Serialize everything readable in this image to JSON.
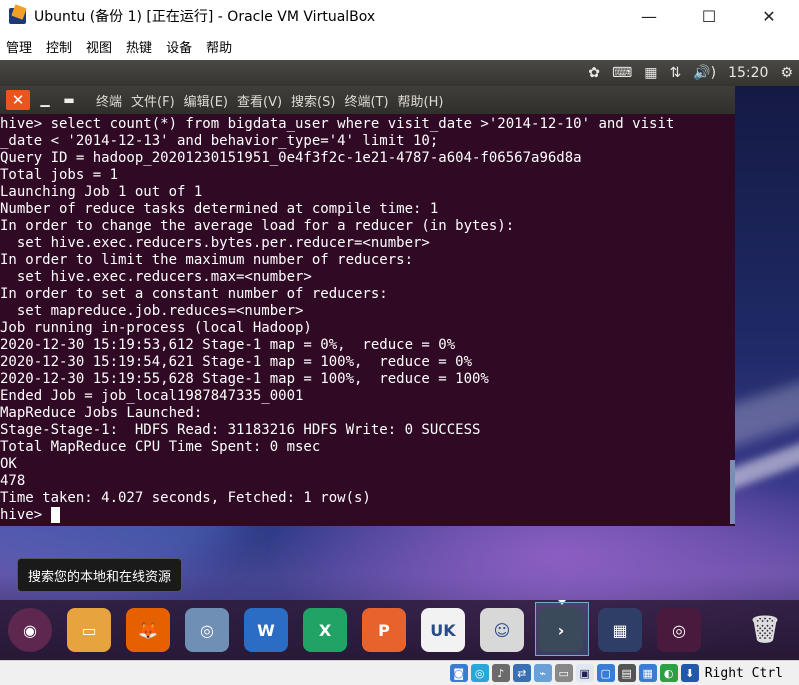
{
  "window": {
    "title": "Ubuntu (备份 1) [正在运行] - Oracle VM VirtualBox",
    "minimize": "—",
    "maximize": "☐",
    "close": "✕"
  },
  "vbox_menu": [
    "管理",
    "控制",
    "视图",
    "热键",
    "设备",
    "帮助"
  ],
  "ubuntu_panel": {
    "time": "15:20",
    "volume_icon": "🔊)",
    "icons": [
      "settings-icon",
      "keyboard-icon",
      "calendar-icon",
      "network-icon",
      "volume-icon"
    ]
  },
  "terminal": {
    "menu": [
      "终端",
      "文件(F)",
      "编辑(E)",
      "查看(V)",
      "搜索(S)",
      "终端(T)",
      "帮助(H)"
    ],
    "lines": [
      "hive> select count(*) from bigdata_user where visit_date >'2014-12-10' and visit",
      "_date < '2014-12-13' and behavior_type='4' limit 10;",
      "Query ID = hadoop_20201230151951_0e4f3f2c-1e21-4787-a604-f06567a96d8a",
      "Total jobs = 1",
      "Launching Job 1 out of 1",
      "Number of reduce tasks determined at compile time: 1",
      "In order to change the average load for a reducer (in bytes):",
      "  set hive.exec.reducers.bytes.per.reducer=<number>",
      "In order to limit the maximum number of reducers:",
      "  set hive.exec.reducers.max=<number>",
      "In order to set a constant number of reducers:",
      "  set mapreduce.job.reduces=<number>",
      "Job running in-process (local Hadoop)",
      "2020-12-30 15:19:53,612 Stage-1 map = 0%,  reduce = 0%",
      "2020-12-30 15:19:54,621 Stage-1 map = 100%,  reduce = 0%",
      "2020-12-30 15:19:55,628 Stage-1 map = 100%,  reduce = 100%",
      "Ended Job = job_local1987847335_0001",
      "MapReduce Jobs Launched:",
      "Stage-Stage-1:  HDFS Read: 31183216 HDFS Write: 0 SUCCESS",
      "Total MapReduce CPU Time Spent: 0 msec",
      "OK",
      "478",
      "Time taken: 4.027 seconds, Fetched: 1 row(s)"
    ],
    "prompt": "hive> "
  },
  "tooltip": "搜索您的本地和在线资源",
  "dock": {
    "items": [
      {
        "name": "ubuntu-search",
        "color": "#5e2750",
        "glyph": "◉"
      },
      {
        "name": "files",
        "color": "#e7a33e",
        "glyph": "▭"
      },
      {
        "name": "firefox",
        "color": "#e66000",
        "glyph": "🦊"
      },
      {
        "name": "settings",
        "color": "#6f8fb4",
        "glyph": "◎"
      },
      {
        "name": "wps-writer",
        "color": "#2b6cc4",
        "glyph": "W"
      },
      {
        "name": "wps-spreadsheet",
        "color": "#21a366",
        "glyph": "X"
      },
      {
        "name": "wps-presentation",
        "color": "#e8632b",
        "glyph": "P"
      },
      {
        "name": "ubuntu-store",
        "color": "#f2f2f2",
        "glyph": "UK"
      },
      {
        "name": "robot",
        "color": "#d8d8d8",
        "glyph": "☺"
      },
      {
        "name": "terminal",
        "color": "#3a4a5a",
        "glyph": "›"
      },
      {
        "name": "workspace-switcher",
        "color": "#2f3e66",
        "glyph": "▦"
      },
      {
        "name": "dvd",
        "color": "#4a1a3e",
        "glyph": "◎"
      },
      {
        "name": "trash",
        "color": "#999999",
        "glyph": "🗑"
      }
    ]
  },
  "statusbar": {
    "host_key": "Right Ctrl"
  }
}
